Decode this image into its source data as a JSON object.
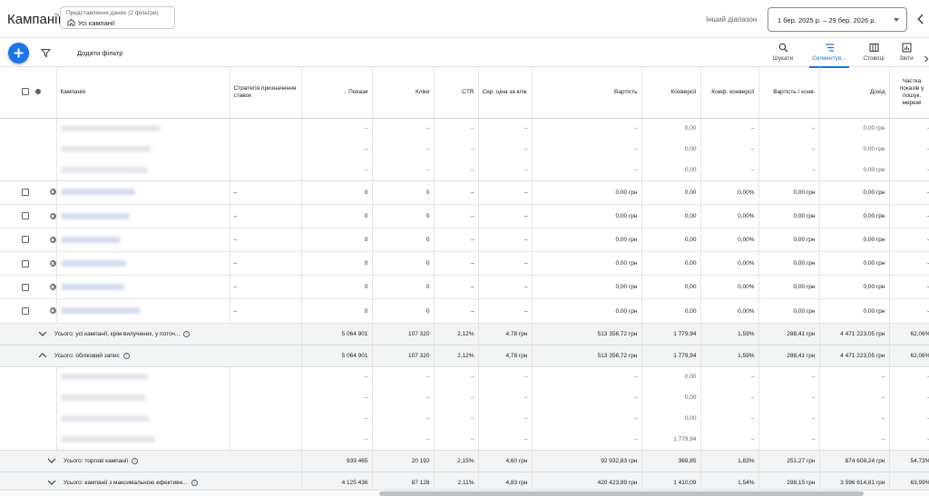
{
  "header": {
    "title": "Кампанії",
    "view_small": "Представлення даних (2 фільтри)",
    "view_main": "Усі кампанії",
    "range_label": "Інший діапазон",
    "date_range": "1 бер. 2025 р. – 29 бер. 2026 р."
  },
  "toolbar": {
    "add_filter": "Додати фільтр",
    "tools": [
      "Шукати",
      "Сегментув...",
      "Стовпці",
      "Звіти"
    ]
  },
  "columns": [
    "Кампанія",
    "Стратегія призначення ставок",
    "Покази",
    "Кліки",
    "CTR",
    "Сер. ціна за клік",
    "Вартість",
    "Конверсії",
    "Коеф. конверсії",
    "Вартість / конв.",
    "Дохід",
    "Частка показів у пошук. мережі"
  ],
  "sub_rows_top": [
    [
      "–",
      "–",
      "–",
      "–",
      "–",
      "0,00",
      "–",
      "–",
      "0,00 грн",
      "–"
    ],
    [
      "–",
      "–",
      "–",
      "–",
      "–",
      "0,00",
      "–",
      "–",
      "0,00 грн",
      "–"
    ],
    [
      "–",
      "–",
      "–",
      "–",
      "–",
      "0,00",
      "–",
      "–",
      "0,00 грн",
      "–"
    ]
  ],
  "campaign_rows": [
    [
      "–",
      "0",
      "0",
      "–",
      "–",
      "0,00 грн",
      "0,00",
      "0,00%",
      "0,00 грн",
      "0,00 грн",
      "–"
    ],
    [
      "–",
      "0",
      "0",
      "–",
      "–",
      "0,00 грн",
      "0,00",
      "0,00%",
      "0,00 грн",
      "0,00 грн",
      "–"
    ],
    [
      "–",
      "0",
      "0",
      "–",
      "–",
      "0,00 грн",
      "0,00",
      "0,00%",
      "0,00 грн",
      "0,00 грн",
      "–"
    ],
    [
      "–",
      "0",
      "0",
      "–",
      "–",
      "0,00 грн",
      "0,00",
      "0,00%",
      "0,00 грн",
      "0,00 грн",
      "–"
    ],
    [
      "–",
      "0",
      "0",
      "–",
      "–",
      "0,00 грн",
      "0,00",
      "0,00%",
      "0,00 грн",
      "0,00 грн",
      "–"
    ],
    [
      "–",
      "0",
      "0",
      "–",
      "–",
      "0,00 грн",
      "0,00",
      "0,00%",
      "0,00 грн",
      "0,00 грн",
      "–"
    ]
  ],
  "totals": {
    "all_except_removed": {
      "label": "Усього: усі кампанії, крім вилучених, у поточ...",
      "values": [
        "5 064 901",
        "107 320",
        "2,12%",
        "4,78 грн",
        "513 356,72 грн",
        "1 779,94",
        "1,59%",
        "288,41 грн",
        "4 471 223,05 грн",
        "62,06%"
      ]
    },
    "account": {
      "label": "Усього: обліковий запис",
      "values": [
        "5 064 901",
        "107 320",
        "2,12%",
        "4,78 грн",
        "513 356,72 грн",
        "1 779,94",
        "1,59%",
        "288,41 грн",
        "4 471 223,05 грн",
        "62,06%"
      ]
    },
    "shopping": {
      "label": "Усього: торгові кампанії",
      "values": [
        "939 465",
        "20 192",
        "2,15%",
        "4,60 грн",
        "92 932,83 грн",
        "369,85",
        "1,83%",
        "251,27 грн",
        "874 608,24 грн",
        "54,73%"
      ]
    },
    "pmax": {
      "label": "Усього: кампанії з максимальною ефективн...",
      "values": [
        "4 125 436",
        "87 128",
        "2,11%",
        "4,83 грн",
        "420 423,89 грн",
        "1 410,09",
        "1,54%",
        "298,15 грн",
        "3 596 614,81 грн",
        "63,99%"
      ]
    }
  },
  "sub_rows_account": [
    [
      "–",
      "–",
      "–",
      "–",
      "–",
      "0,00",
      "–",
      "–",
      "–",
      "–"
    ],
    [
      "–",
      "–",
      "–",
      "–",
      "–",
      "0,00",
      "–",
      "–",
      "–",
      "–"
    ],
    [
      "–",
      "–",
      "–",
      "–",
      "–",
      "0,00",
      "–",
      "–",
      "–",
      "–"
    ],
    [
      "–",
      "–",
      "–",
      "–",
      "–",
      "1 779,94",
      "–",
      "–",
      "–",
      "–"
    ]
  ]
}
